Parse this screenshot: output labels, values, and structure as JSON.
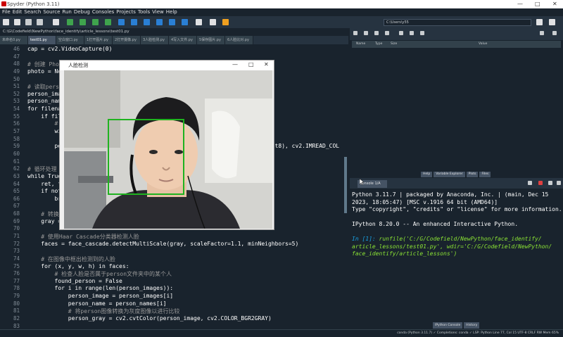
{
  "window": {
    "title": "Spyder (Python 3.11)"
  },
  "menu": [
    "File",
    "Edit",
    "Search",
    "Source",
    "Run",
    "Debug",
    "Consoles",
    "Projects",
    "Tools",
    "View",
    "Help"
  ],
  "toolbar": {
    "working_dir": "C:\\Users\\y55"
  },
  "editor": {
    "path": "C:\\G\\Codefield\\NewPython\\face_identify\\article_lessons\\test01.py",
    "tabs": [
      "未命名0.py",
      "test01.py",
      "空白窗口.py",
      "1打开图片.py",
      "2打开摄像.py",
      "3人脸检测.py",
      "4写入文件.py",
      "5保存图片.py",
      "6人脸比对.py"
    ],
    "active_tab": 1,
    "line_numbers": [
      "46",
      "47",
      "48",
      "49",
      "50",
      "51",
      "52",
      "53",
      "54",
      "55",
      "56",
      "57",
      "58",
      "59",
      "60",
      "61",
      "62",
      "63",
      "64",
      "65",
      "66",
      "67",
      "68",
      "69",
      "70",
      "71",
      "72",
      "73",
      "74",
      "75",
      "76",
      "77",
      "78",
      "79",
      "80",
      "81",
      "82",
      "83"
    ],
    "lines": [
      "cap = cv2.VideoCapture(0)",
      "",
      "# 创建 Photo",
      "photo = Non",
      "",
      "# 读取person",
      "person_image",
      "person_name",
      "for filenam",
      "    if fil",
      "        #",
      "        wi",
      "",
      "        per                                                             nt8), cv2.IMREAD_COL",
      "",
      "",
      "# 循环处理",
      "while True",
      "    ret, f",
      "    if not",
      "        br",
      "",
      "    # 转换",
      "    gray =",
      "",
      "    # 使用Haar Cascade分类器检测人脸",
      "    faces = face_cascade.detectMultiScale(gray, scaleFactor=1.1, minNeighbors=5)",
      "",
      "    # 在图像中框出检测到的人脸",
      "    for (x, y, w, h) in faces:",
      "        # 检查人脸是否属于person文件夹中的某个人",
      "        found_person = False",
      "        for i in range(len(person_images)):",
      "            person_image = person_images[i]",
      "            person_name = person_names[i]",
      "            # 将person图像转换为灰度图像以进行比较",
      "            person_gray = cv2.cvtColor(person_image, cv2.COLOR_BGR2GRAY)",
      ""
    ]
  },
  "camera_window": {
    "title": "人脸检测",
    "controls": [
      "—",
      "□",
      "✕"
    ]
  },
  "variable_explorer": {
    "columns": [
      "Name",
      "Type",
      "Size",
      "Value"
    ]
  },
  "right_tabs": [
    "Help",
    "Variable Explorer",
    "Plots",
    "Files"
  ],
  "console": {
    "tab": "Console 1/A",
    "lines": [
      "Python 3.11.7 | packaged by Anaconda, Inc. | (main, Dec 15",
      "2023, 18:05:47) [MSC v.1916 64 bit (AMD64)]",
      "Type \"copyright\", \"credits\" or \"license\" for more information.",
      "",
      "IPython 8.20.0 -- An enhanced Interactive Python.",
      "",
      "In [1]: runfile('C:/G/Codefield/NewPython/face_identify/",
      "article_lessons/test01.py', wdir='C:/G/Codefield/NewPython/",
      "face_identify/article_lessons')"
    ]
  },
  "bottom_tabs": [
    "IPython Console",
    "History"
  ],
  "statusbar": "conda (Python 3.11.7)   ✓ Completions: conda   ✓ LSP: Python   Line 77, Col 15   UTF-8   CRLF   RW   Mem 65%",
  "colors": {
    "bg": "#19232d",
    "panel": "#263340",
    "face_box": "#1fb31f"
  }
}
